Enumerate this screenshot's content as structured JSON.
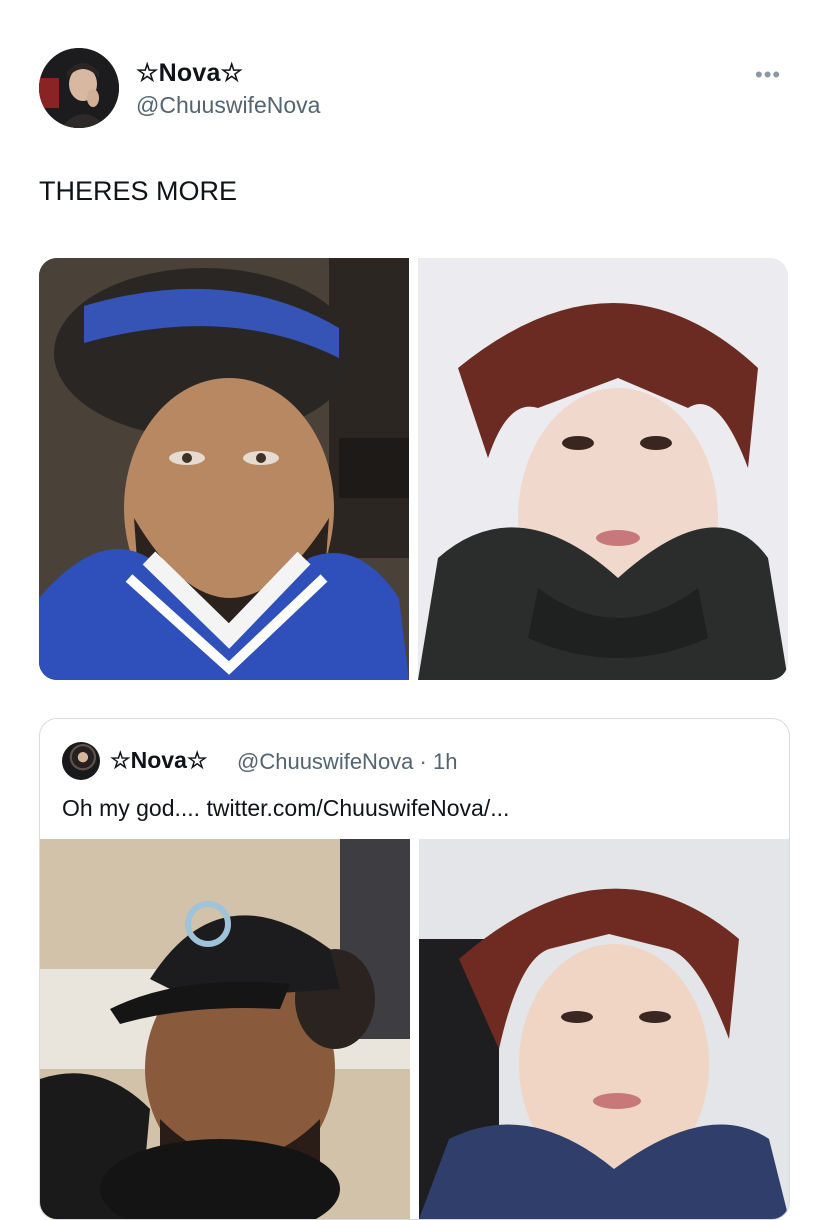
{
  "tweet": {
    "display_name": "☆Nova☆",
    "handle": "@ChuuswifeNova",
    "more_label": "•••",
    "text": "THERES MORE",
    "media": [
      {
        "description_icon": "photo-man-blue-headband"
      },
      {
        "description_icon": "photo-red-haired-person-hoodie"
      }
    ]
  },
  "quote": {
    "display_name": "☆Nova☆",
    "handle_time": "@ChuuswifeNova · 1h",
    "text": "Oh my god.... twitter.com/ChuuswifeNova/...",
    "media": [
      {
        "description_icon": "photo-man-black-cap"
      },
      {
        "description_icon": "photo-red-haired-person-sweater"
      }
    ]
  }
}
